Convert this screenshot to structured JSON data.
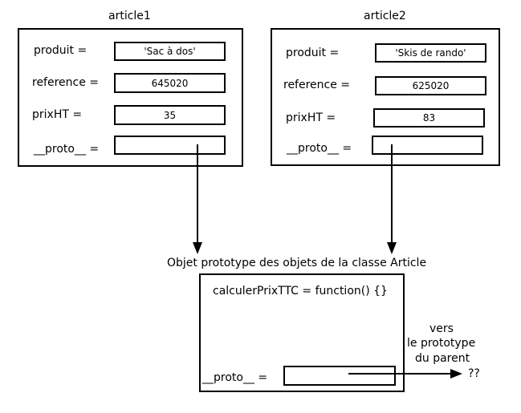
{
  "objects": [
    {
      "name": "article1",
      "fields": [
        {
          "label": "produit =",
          "value": "'Sac à dos'"
        },
        {
          "label": "reference =",
          "value": "645020"
        },
        {
          "label": "prixHT =",
          "value": "35"
        },
        {
          "label": "__proto__ =",
          "value": ""
        }
      ]
    },
    {
      "name": "article2",
      "fields": [
        {
          "label": "produit =",
          "value": "'Skis de rando'"
        },
        {
          "label": "reference =",
          "value": "625020"
        },
        {
          "label": "prixHT =",
          "value": "83"
        },
        {
          "label": "__proto__ =",
          "value": ""
        }
      ]
    }
  ],
  "prototype": {
    "title": "Objet prototype des objets de la classe Article",
    "method": "calculerPrixTTC = function() {}",
    "proto_label": "__proto__ =",
    "proto_value": ""
  },
  "parent_note": {
    "lines": [
      "vers",
      "le prototype",
      "du parent"
    ],
    "target": "??"
  }
}
